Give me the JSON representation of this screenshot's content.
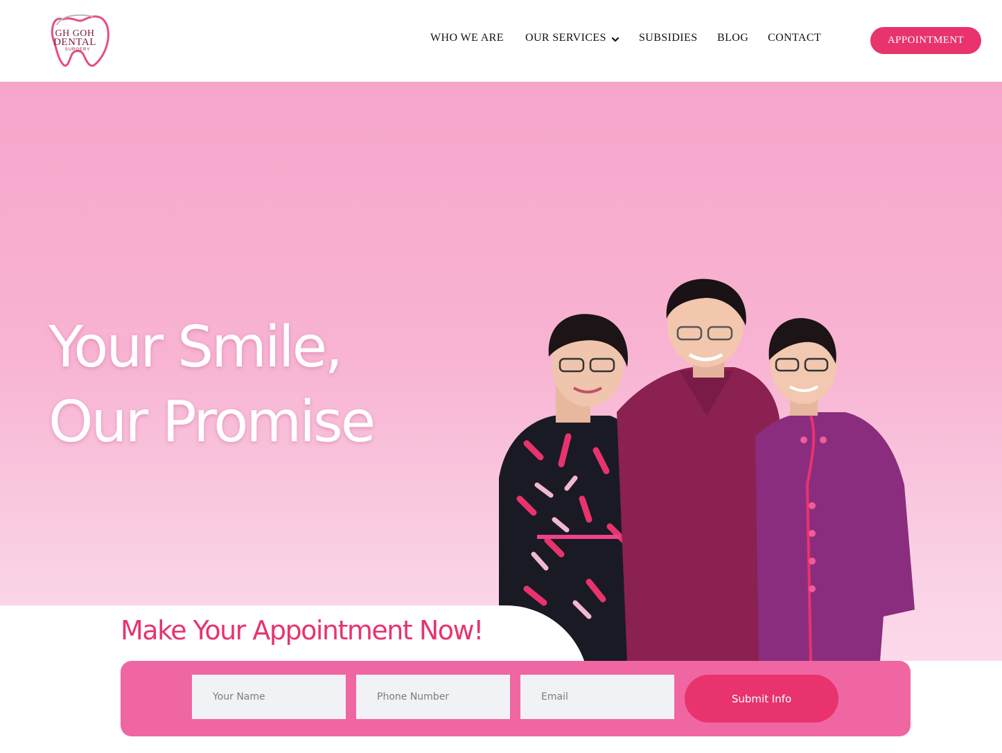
{
  "brand": {
    "logo_line1": "GH GOH",
    "logo_line2": "DENTAL",
    "logo_line3": "SURGERY",
    "primary_color": "#e8336d",
    "hero_color": "#f7a6cb"
  },
  "nav": {
    "items": [
      {
        "label": "WHO WE ARE"
      },
      {
        "label": "OUR SERVICES",
        "icon": "chevron-down-icon"
      },
      {
        "label": "SUBSIDIES"
      },
      {
        "label": "BLOG"
      },
      {
        "label": "CONTACT"
      }
    ],
    "cta_label": "APPOINTMENT"
  },
  "hero": {
    "headline_line1": "Your Smile,",
    "headline_line2": "Our Promise",
    "photo": "three-dental-staff-in-purple-and-patterned-scrubs"
  },
  "form": {
    "title": "Make Your Appointment Now!",
    "name_placeholder": "Your Name",
    "phone_placeholder": "Phone Number",
    "email_placeholder": "Email",
    "submit_label": "Submit Info"
  }
}
